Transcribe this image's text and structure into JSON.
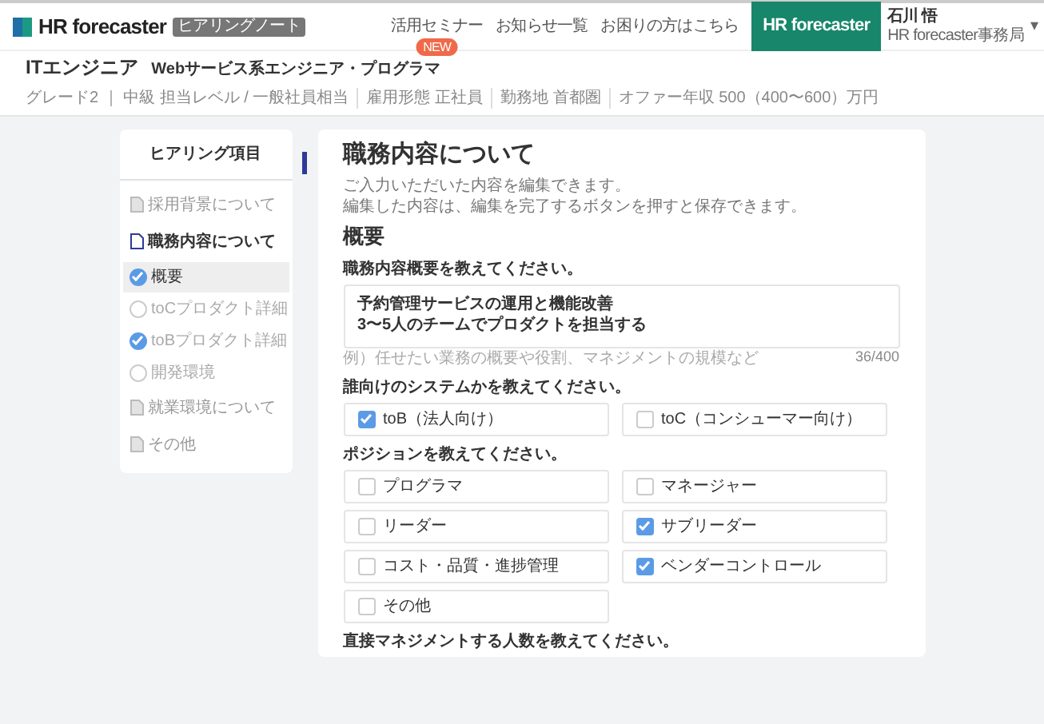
{
  "header": {
    "logo": "HR forecaster",
    "logo_badge": "ヒアリングノート",
    "nav": [
      {
        "label": "活用セミナー",
        "badge": "NEW"
      },
      {
        "label": "お知らせ一覧"
      },
      {
        "label": "お困りの方はこちら"
      }
    ],
    "brand_button": "HR forecaster",
    "user": {
      "name": "石川 悟",
      "org": "HR forecaster事務局"
    },
    "caret": "▾"
  },
  "job": {
    "title": "ITエンジニア",
    "subtitle": "Webサービス系エンジニア・プログラマ",
    "meta": [
      "グレード2 ｜ 中級 担当レベル / 一般社員相当",
      "雇用形態 正社員",
      "勤務地 首都圏",
      "オファー年収 500（400〜600）万円"
    ]
  },
  "sidebar": {
    "title": "ヒアリング項目",
    "items": [
      {
        "label": "採用背景について",
        "active": false
      },
      {
        "label": "職務内容について",
        "active": true,
        "children": [
          {
            "label": "概要",
            "checked": true,
            "selected": true
          },
          {
            "label": "toCプロダクト詳細",
            "checked": false,
            "selected": false
          },
          {
            "label": "toBプロダクト詳細",
            "checked": true,
            "selected": false
          },
          {
            "label": "開発環境",
            "checked": false,
            "selected": false
          }
        ]
      },
      {
        "label": "就業環境について",
        "active": false
      },
      {
        "label": "その他",
        "active": false
      }
    ]
  },
  "main": {
    "title": "職務内容について",
    "description": [
      "ご入力いただいた内容を編集できます。",
      "編集した内容は、編集を完了するボタンを押すと保存できます。"
    ],
    "section": "概要",
    "questions": [
      {
        "kind": "text",
        "label": "職務内容概要を教えてください。",
        "value": "予約管理サービスの運用と機能改善\n3〜5人のチームでプロダクトを担当する",
        "hint": "例）任せたい業務の概要や役割、マネジメントの規模など",
        "counter": "36/400"
      },
      {
        "kind": "checkboxes",
        "label": "誰向けのシステムかを教えてください。",
        "options": [
          {
            "label": "toB（法人向け）",
            "checked": true
          },
          {
            "label": "toC（コンシューマー向け）",
            "checked": false
          }
        ]
      },
      {
        "kind": "checkboxes",
        "label": "ポジションを教えてください。",
        "options": [
          {
            "label": "プログラマ",
            "checked": false
          },
          {
            "label": "マネージャー",
            "checked": false
          },
          {
            "label": "リーダー",
            "checked": false
          },
          {
            "label": "サブリーダー",
            "checked": true
          },
          {
            "label": "コスト・品質・進捗管理",
            "checked": false
          },
          {
            "label": "ベンダーコントロール",
            "checked": true
          },
          {
            "label": "その他",
            "checked": false
          }
        ]
      },
      {
        "kind": "checkboxes",
        "label": "直接マネジメントする人数を教えてください。"
      }
    ]
  }
}
